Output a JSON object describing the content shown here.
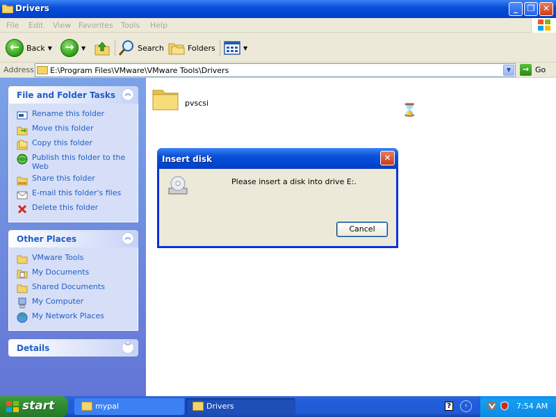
{
  "window": {
    "title": "Drivers",
    "minimize": "_",
    "maximize": "❐",
    "close": "✕"
  },
  "menu": [
    {
      "label": "File"
    },
    {
      "label": "Edit"
    },
    {
      "label": "View"
    },
    {
      "label": "Favorites"
    },
    {
      "label": "Tools"
    },
    {
      "label": "Help"
    }
  ],
  "toolbar": {
    "back": "Back",
    "search": "Search",
    "folders": "Folders"
  },
  "address": {
    "label": "Address",
    "path": "E:\\Program Files\\VMware\\VMware Tools\\Drivers",
    "go": "Go"
  },
  "tasks": {
    "file_folder": {
      "title": "File and Folder Tasks",
      "items": [
        {
          "label": "Rename this folder",
          "icon": "rename-icon"
        },
        {
          "label": "Move this folder",
          "icon": "move-icon"
        },
        {
          "label": "Copy this folder",
          "icon": "copy-icon"
        },
        {
          "label": "Publish this folder to the Web",
          "icon": "globe-icon"
        },
        {
          "label": "Share this folder",
          "icon": "share-icon"
        },
        {
          "label": "E-mail this folder's files",
          "icon": "email-icon"
        },
        {
          "label": "Delete this folder",
          "icon": "delete-icon"
        }
      ]
    },
    "other_places": {
      "title": "Other Places",
      "items": [
        {
          "label": "VMware Tools",
          "icon": "folder-icon"
        },
        {
          "label": "My Documents",
          "icon": "my-documents-icon"
        },
        {
          "label": "Shared Documents",
          "icon": "folder-icon"
        },
        {
          "label": "My Computer",
          "icon": "computer-icon"
        },
        {
          "label": "My Network Places",
          "icon": "network-icon"
        }
      ]
    },
    "details": {
      "title": "Details"
    }
  },
  "content": {
    "folders": [
      {
        "name": "pvscsi"
      }
    ]
  },
  "dialog": {
    "title": "Insert disk",
    "message": "Please insert a disk into drive E:.",
    "cancel": "Cancel",
    "close": "✕"
  },
  "taskbar": {
    "start": "start",
    "buttons": [
      {
        "label": "mypal"
      },
      {
        "label": "Drivers"
      }
    ],
    "help": "?",
    "clock": "7:54 AM"
  },
  "colors": {
    "title_blue": "#0a4fd8",
    "task_pane": "#7ba2e7",
    "link_blue": "#215dc6",
    "start_green": "#2f8a2f"
  }
}
